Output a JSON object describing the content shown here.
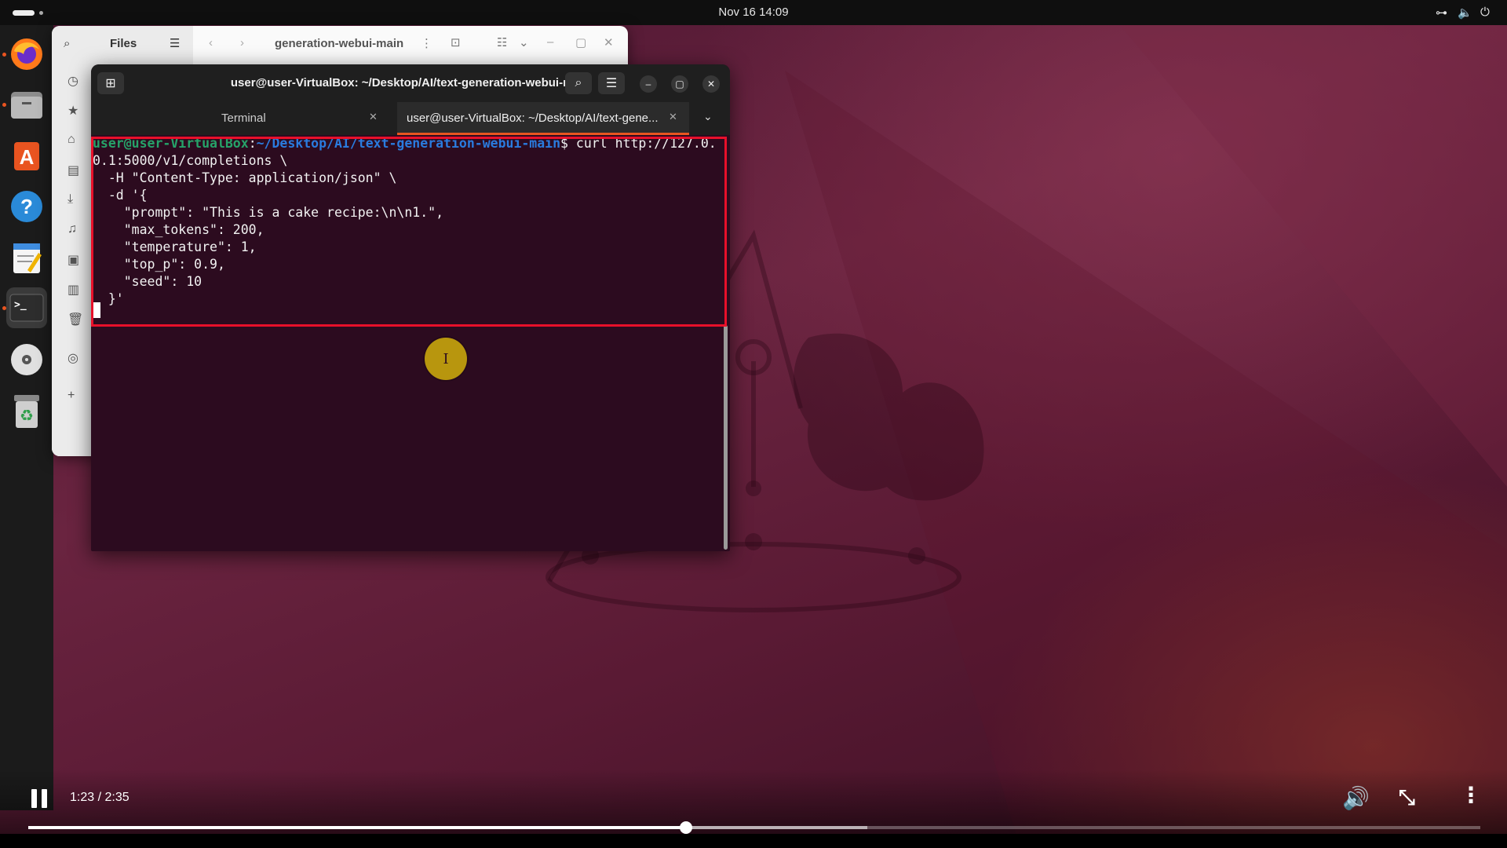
{
  "topbar": {
    "clock": "Nov 16  14:09"
  },
  "dock": {
    "items": [
      {
        "name": "firefox",
        "glyph": "🦊"
      },
      {
        "name": "files",
        "glyph": "▭"
      },
      {
        "name": "app-center",
        "glyph": "A"
      },
      {
        "name": "help",
        "glyph": "?"
      },
      {
        "name": "text-editor",
        "glyph": "✎"
      },
      {
        "name": "terminal",
        "glyph": ">_"
      },
      {
        "name": "disc",
        "glyph": "◉"
      },
      {
        "name": "trash",
        "glyph": "♻"
      }
    ]
  },
  "files_window": {
    "title": "Files",
    "path": "generation-webui-main"
  },
  "terminal": {
    "title": "user@user-VirtualBox: ~/Desktop/AI/text-generation-webui-main",
    "tabs": [
      {
        "label": "Terminal"
      },
      {
        "label": "user@user-VirtualBox: ~/Desktop/AI/text-gene..."
      }
    ],
    "prompt_user": "user@user-VirtualBox",
    "prompt_sep": ":",
    "prompt_path": "~/Desktop/AI/text-generation-webui-main",
    "prompt_cmd": "$ curl http://127.0.",
    "lines": [
      "0.1:5000/v1/completions \\",
      "  -H \"Content-Type: application/json\" \\",
      "  -d '{",
      "    \"prompt\": \"This is a cake recipe:\\n\\n1.\",",
      "    \"max_tokens\": 200,",
      "    \"temperature\": 1,",
      "    \"top_p\": 0.9,",
      "    \"seed\": 10",
      "  }'"
    ]
  },
  "player": {
    "time": "1:23 / 2:35",
    "progress": 0.453,
    "buffered": 0.578
  }
}
